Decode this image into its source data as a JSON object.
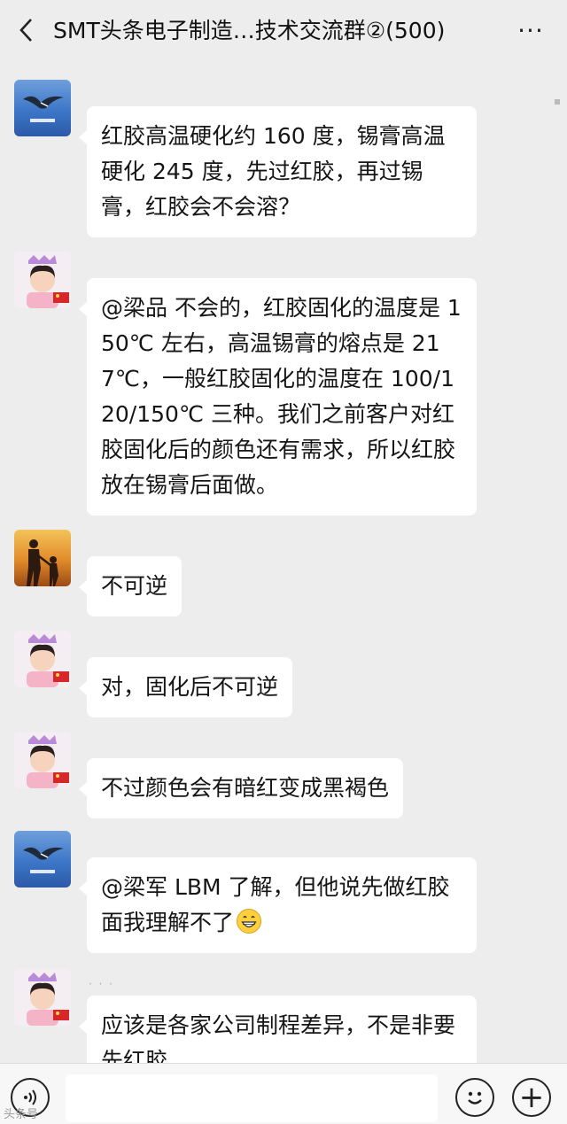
{
  "header": {
    "title": "SMT头条电子制造…技术交流群②(500)",
    "more_label": "···"
  },
  "messages": [
    {
      "avatar": "seagull-avatar",
      "text": "红胶高温硬化约 160 度，锡膏高温硬化 245 度，先过红胶，再过锡膏，红胶会不会溶？"
    },
    {
      "avatar": "girl-avatar",
      "text": "@梁品  不会的，红胶固化的温度是 150℃ 左右，高温锡膏的熔点是 217℃，一般红胶固化的温度在 100/120/150℃ 三种。我们之前客户对红胶固化后的颜色还有需求，所以红胶放在锡膏后面做。"
    },
    {
      "avatar": "family-avatar",
      "text": "不可逆"
    },
    {
      "avatar": "girl-avatar",
      "text": "对，固化后不可逆"
    },
    {
      "avatar": "girl-avatar",
      "text": "不过颜色会有暗红变成黑褐色"
    },
    {
      "avatar": "seagull-avatar",
      "text": "@梁军  LBM 了解，但他说先做红胶面我理解不了",
      "emoji": "grin-emoji"
    },
    {
      "avatar": "girl-avatar",
      "text": "应该是各家公司制程差异，不是非要先红胶"
    }
  ],
  "typing_indicator": "· · ·",
  "bottom_bar": {
    "plus_label": "+"
  },
  "watermark": "头条号"
}
